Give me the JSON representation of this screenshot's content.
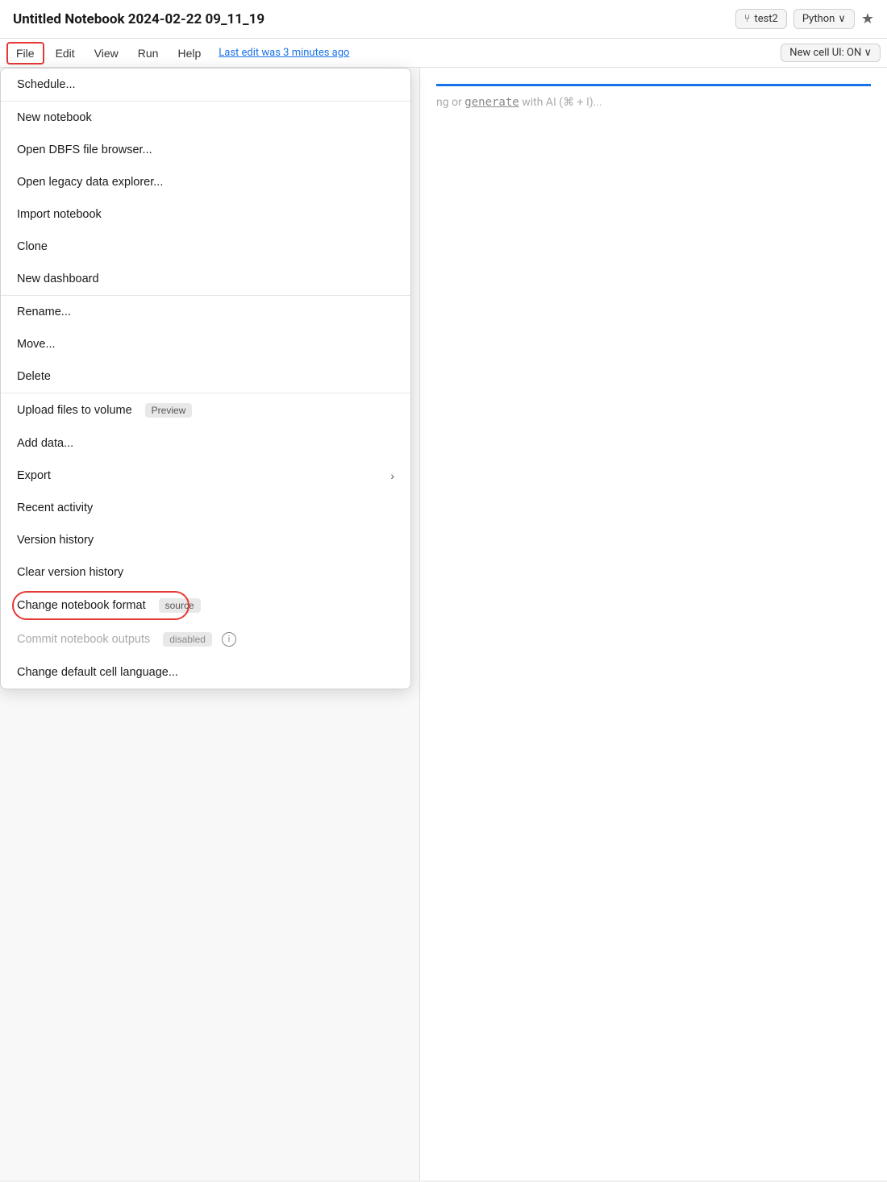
{
  "topbar": {
    "title": "Untitled Notebook 2024-02-22 09_11_19",
    "branch": "test2",
    "language": "Python",
    "language_chevron": "∨",
    "star_icon": "★",
    "git_icon": "⑂"
  },
  "menubar": {
    "items": [
      {
        "label": "File",
        "active": true
      },
      {
        "label": "Edit",
        "active": false
      },
      {
        "label": "View",
        "active": false
      },
      {
        "label": "Run",
        "active": false
      },
      {
        "label": "Help",
        "active": false
      }
    ],
    "last_edit": "Last edit was 3 minutes ago",
    "new_cell_label": "New cell UI: ON ∨"
  },
  "cell_area": {
    "hint": "ng or generate with AI (⌘ + I)..."
  },
  "dropdown": {
    "sections": [
      {
        "items": [
          {
            "id": "schedule",
            "label": "Schedule...",
            "badge": null,
            "disabled": false,
            "chevron": false,
            "info": false
          }
        ]
      },
      {
        "items": [
          {
            "id": "new-notebook",
            "label": "New notebook",
            "badge": null,
            "disabled": false,
            "chevron": false,
            "info": false
          },
          {
            "id": "open-dbfs",
            "label": "Open DBFS file browser...",
            "badge": null,
            "disabled": false,
            "chevron": false,
            "info": false
          },
          {
            "id": "open-legacy",
            "label": "Open legacy data explorer...",
            "badge": null,
            "disabled": false,
            "chevron": false,
            "info": false
          },
          {
            "id": "import-notebook",
            "label": "Import notebook",
            "badge": null,
            "disabled": false,
            "chevron": false,
            "info": false
          },
          {
            "id": "clone",
            "label": "Clone",
            "badge": null,
            "disabled": false,
            "chevron": false,
            "info": false
          },
          {
            "id": "new-dashboard",
            "label": "New dashboard",
            "badge": null,
            "disabled": false,
            "chevron": false,
            "info": false
          }
        ]
      },
      {
        "items": [
          {
            "id": "rename",
            "label": "Rename...",
            "badge": null,
            "disabled": false,
            "chevron": false,
            "info": false
          },
          {
            "id": "move",
            "label": "Move...",
            "badge": null,
            "disabled": false,
            "chevron": false,
            "info": false
          },
          {
            "id": "delete",
            "label": "Delete",
            "badge": null,
            "disabled": false,
            "chevron": false,
            "info": false
          }
        ]
      },
      {
        "items": [
          {
            "id": "upload-files",
            "label": "Upload files to volume",
            "badge": "Preview",
            "disabled": false,
            "chevron": false,
            "info": false
          },
          {
            "id": "add-data",
            "label": "Add data...",
            "badge": null,
            "disabled": false,
            "chevron": false,
            "info": false
          },
          {
            "id": "export",
            "label": "Export",
            "badge": null,
            "disabled": false,
            "chevron": true,
            "info": false
          },
          {
            "id": "recent-activity",
            "label": "Recent activity",
            "badge": null,
            "disabled": false,
            "chevron": false,
            "info": false
          },
          {
            "id": "version-history",
            "label": "Version history",
            "badge": null,
            "disabled": false,
            "chevron": false,
            "info": false
          },
          {
            "id": "clear-version-history",
            "label": "Clear version history",
            "badge": null,
            "disabled": false,
            "chevron": false,
            "info": false
          },
          {
            "id": "change-notebook-format",
            "label": "Change notebook format",
            "badge": "source",
            "disabled": false,
            "chevron": false,
            "info": false,
            "highlighted": true
          },
          {
            "id": "commit-notebook-outputs",
            "label": "Commit notebook outputs",
            "badge": "disabled",
            "disabled": true,
            "chevron": false,
            "info": true
          },
          {
            "id": "change-default-cell",
            "label": "Change default cell language...",
            "badge": null,
            "disabled": false,
            "chevron": false,
            "info": false
          }
        ]
      }
    ]
  }
}
